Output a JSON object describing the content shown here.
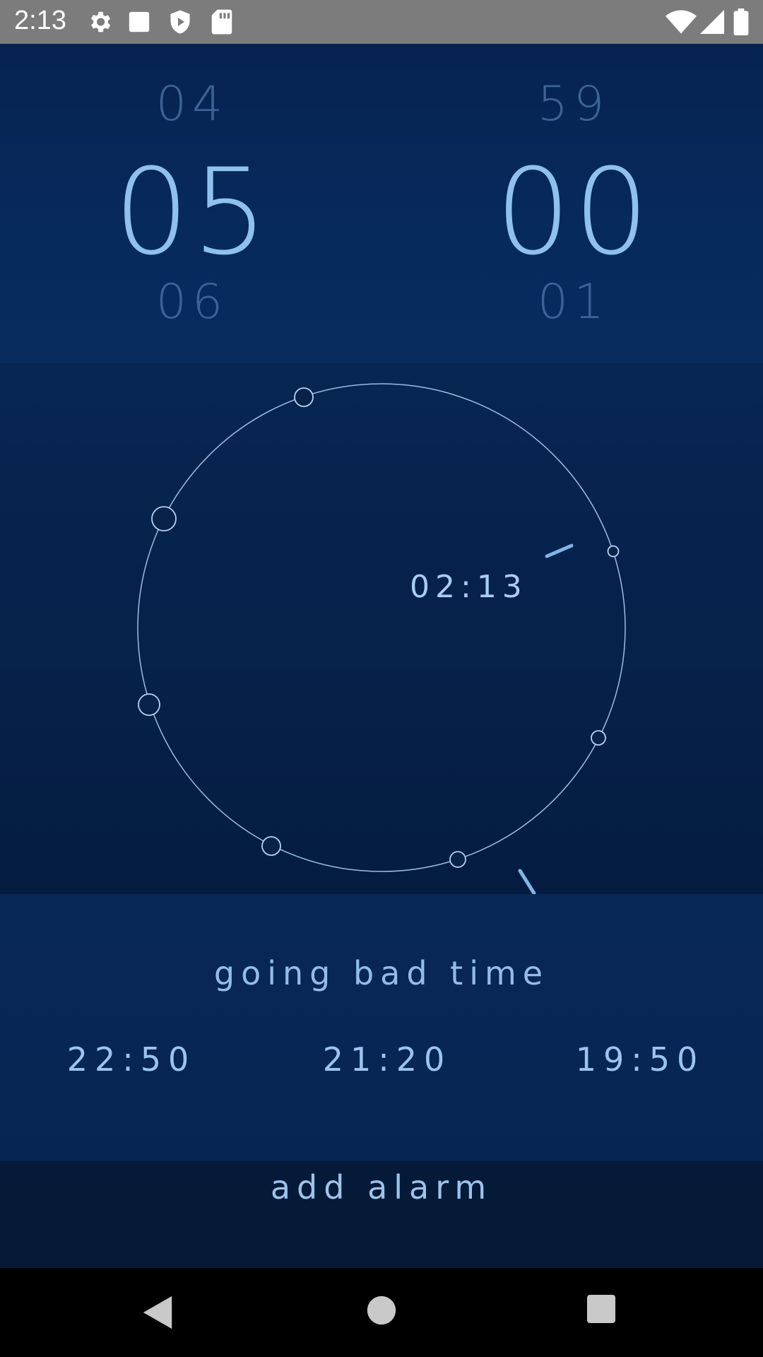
{
  "status_bar": {
    "time": "2:13",
    "left_icons": [
      "gear-icon",
      "square-icon",
      "shield-play-icon",
      "sd-card-icon"
    ],
    "right_icons": [
      "wifi-icon",
      "signal-icon",
      "battery-icon"
    ]
  },
  "picker": {
    "hours": {
      "prev": "04",
      "current": "05",
      "next": "06"
    },
    "minutes": {
      "prev": "59",
      "current": "00",
      "next": "01"
    }
  },
  "dial": {
    "current_time": "02:13",
    "alarm_marker_count": 7
  },
  "info": {
    "caption": "going bad time",
    "alarm_times": [
      "22:50",
      "21:20",
      "19:50"
    ]
  },
  "add_alarm": {
    "label": "add alarm"
  },
  "nav": {
    "buttons": [
      "back-icon",
      "home-icon",
      "recents-icon"
    ]
  },
  "colors": {
    "background": "#062452",
    "accent": "#8ec1ec",
    "dim_text": "#3d6396",
    "status_bar": "#7c7c7c"
  }
}
